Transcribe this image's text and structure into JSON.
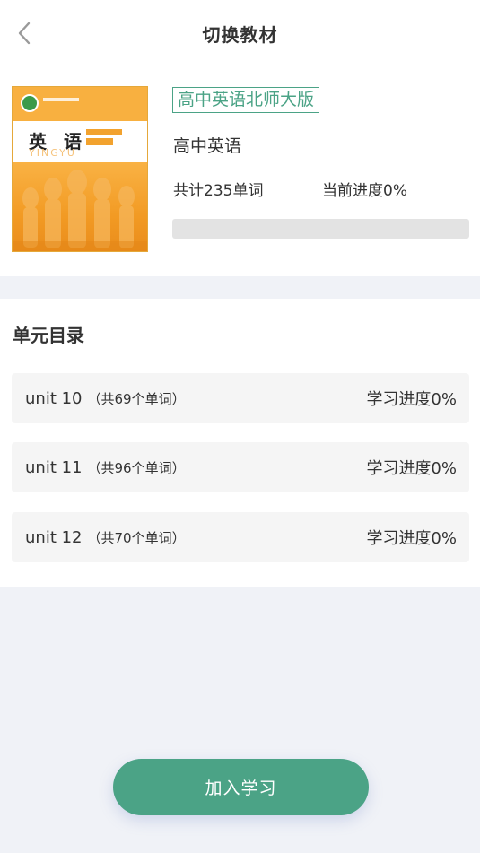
{
  "header": {
    "title": "切换教材",
    "back_icon": "chevron-left-icon"
  },
  "book": {
    "tag": "高中英语北师大版",
    "subject": "高中英语",
    "word_count": "共计235单词",
    "progress_label": "当前进度0%",
    "progress_fraction": 0,
    "cover": {
      "title": "英 语",
      "subtitle": "YINGYU"
    }
  },
  "units": {
    "title": "单元目录",
    "items": [
      {
        "name": "unit 10",
        "count": "（共69个单词）",
        "progress": "学习进度0%"
      },
      {
        "name": "unit 11",
        "count": "（共96个单词）",
        "progress": "学习进度0%"
      },
      {
        "name": "unit 12",
        "count": "（共70个单词）",
        "progress": "学习进度0%"
      }
    ]
  },
  "action": {
    "join_label": "加入学习"
  },
  "colors": {
    "accent": "#4ba386",
    "background": "#f0f2f7",
    "row_background": "#f5f5f5",
    "progress_track": "#e3e3e3"
  }
}
